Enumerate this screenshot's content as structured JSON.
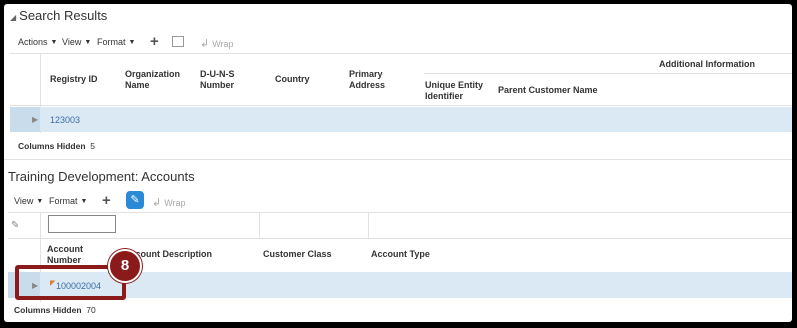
{
  "search_results": {
    "title": "Search Results",
    "toolbar": {
      "actions": "Actions",
      "view": "View",
      "format": "Format",
      "wrap": "Wrap"
    },
    "group_header": "Additional Information",
    "columns": [
      "Registry ID",
      "Organization Name",
      "D-U-N-S Number",
      "Country",
      "Primary Address",
      "Unique Entity Identifier",
      "Parent Customer Name"
    ],
    "rows": [
      {
        "registry_id": "123003"
      }
    ],
    "columns_hidden_label": "Columns Hidden",
    "columns_hidden_count": "5"
  },
  "accounts": {
    "title": "Training Development: Accounts",
    "toolbar": {
      "view": "View",
      "format": "Format",
      "wrap": "Wrap"
    },
    "columns": [
      "Account Number",
      "Account Description",
      "Customer Class",
      "Account Type"
    ],
    "rows": [
      {
        "account_number": "100002004"
      }
    ],
    "columns_hidden_label": "Columns Hidden",
    "columns_hidden_count": "70"
  },
  "callout": {
    "number": "8",
    "color": "#8b1b1b"
  },
  "colors": {
    "selected_row": "#dbe9f5",
    "link": "#3a6ea5",
    "primary_button": "#2b8ad6"
  }
}
